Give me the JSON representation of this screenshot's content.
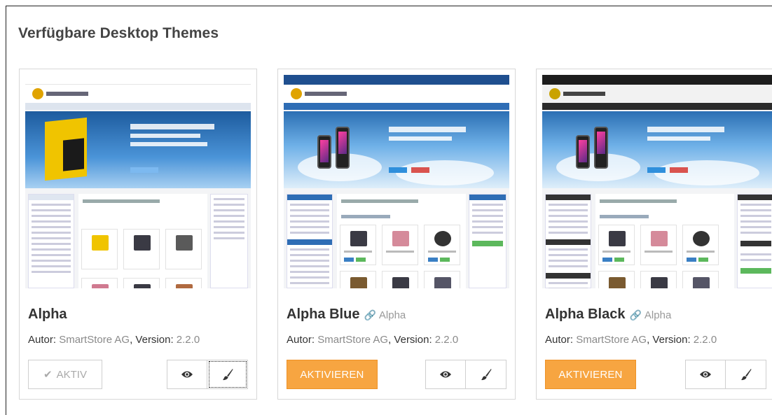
{
  "page": {
    "title": "Verfügbare Desktop Themes"
  },
  "labels": {
    "author": "Autor:",
    "version": "Version:",
    "active": "AKTIV",
    "activate": "AKTIVIEREN"
  },
  "themes": [
    {
      "name": "Alpha",
      "parent": "",
      "author": "SmartStore AG",
      "version": "2.2.0",
      "state": "active",
      "colors": {
        "topbar": "#ffffff",
        "nav": "#2e5ea8",
        "sidebar_header": "#dfe6f0"
      }
    },
    {
      "name": "Alpha Blue",
      "parent": "Alpha",
      "author": "SmartStore AG",
      "version": "2.2.0",
      "state": "inactive",
      "colors": {
        "topbar": "#1f4f8f",
        "nav": "#2e6db5",
        "sidebar_header": "#2e6db5"
      }
    },
    {
      "name": "Alpha Black",
      "parent": "Alpha",
      "author": "SmartStore AG",
      "version": "2.2.0",
      "state": "inactive",
      "colors": {
        "topbar": "#1d1d1d",
        "nav": "#2b2b2b",
        "sidebar_header": "#333333"
      }
    }
  ],
  "icons": {
    "active": "check-icon",
    "parent": "link-icon",
    "preview": "eye-icon",
    "configure": "brush-icon"
  },
  "accent": {
    "activate_button": "#f7a541"
  }
}
